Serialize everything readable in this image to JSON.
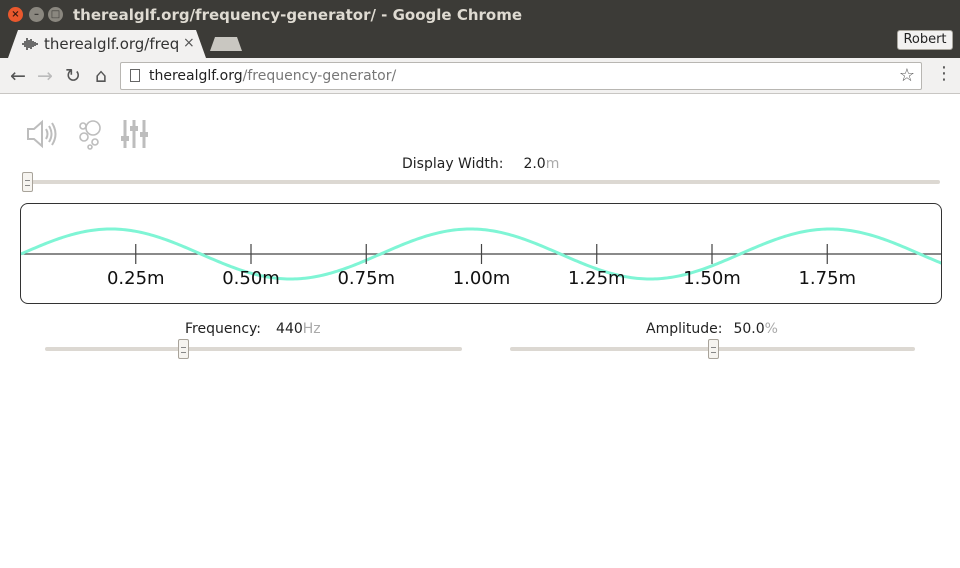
{
  "window": {
    "title": "therealglf.org/frequency-generator/ - Google Chrome",
    "close_glyph": "×",
    "min_glyph": "–",
    "max_glyph": "□"
  },
  "tab": {
    "title": "therealglf.org/freq",
    "close_glyph": "×",
    "favicon": "waveform-icon"
  },
  "profile": {
    "name": "Robert"
  },
  "toolbar": {
    "back_glyph": "←",
    "forward_glyph": "→",
    "reload_glyph": "↻",
    "home_glyph": "⌂",
    "star_glyph": "☆",
    "menu_glyph": "⋮",
    "url_host": "therealglf.org",
    "url_path": "/frequency-generator/"
  },
  "controls": {
    "icons": [
      "speaker-icon",
      "bubbles-icon",
      "sliders-icon"
    ],
    "display_width": {
      "label": "Display Width:",
      "value": "2.0",
      "unit": "m",
      "slider_level": 0.0
    },
    "frequency": {
      "label": "Frequency:",
      "value": "440",
      "unit": "Hz",
      "slider_level": 0.33
    },
    "amplitude": {
      "label": "Amplitude:",
      "value": "50.0",
      "unit": "%",
      "slider_level": 0.5
    }
  },
  "waveform": {
    "wave_color": "#7ff5d5",
    "axis_color": "#444444",
    "display_width_m": 2.0,
    "wavelength_m": 0.78,
    "amplitude_fraction": 0.5,
    "ticks": [
      "0.25m",
      "0.50m",
      "0.75m",
      "1.00m",
      "1.25m",
      "1.50m",
      "1.75m"
    ]
  }
}
